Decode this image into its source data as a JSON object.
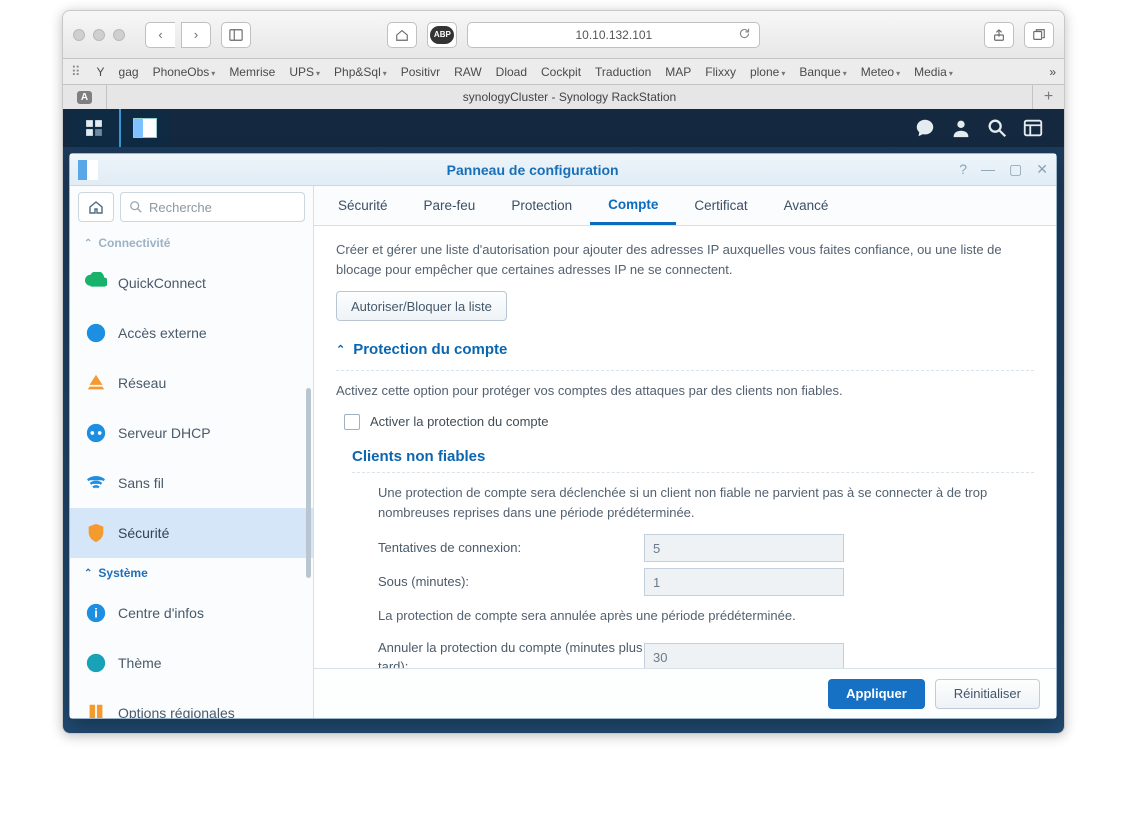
{
  "browser": {
    "address": "10.10.132.101",
    "tab_close_count": "A",
    "tab_title": "synologyCluster - Synology RackStation",
    "bookmarks": [
      "Y",
      "gag",
      "PhoneObs",
      "Memrise",
      "UPS",
      "Php&Sql",
      "Positivr",
      "RAW",
      "Dload",
      "Cockpit",
      "Traduction",
      "MAP",
      "Flixxy",
      "plone",
      "Banque",
      "Meteo",
      "Media"
    ],
    "bookmark_has_menu": [
      false,
      false,
      true,
      false,
      true,
      true,
      false,
      false,
      false,
      false,
      false,
      false,
      false,
      true,
      true,
      true,
      true
    ]
  },
  "cp": {
    "title": "Panneau de configuration",
    "search_placeholder": "Recherche",
    "section_connectivity": "Connectivité",
    "section_system": "Système",
    "nav": {
      "quickconnect": "QuickConnect",
      "external": "Accès externe",
      "network": "Réseau",
      "dhcp": "Serveur DHCP",
      "wifi": "Sans fil",
      "security": "Sécurité",
      "infocenter": "Centre d'infos",
      "theme": "Thème",
      "regional": "Options régionales"
    },
    "tabs": {
      "security": "Sécurité",
      "firewall": "Pare-feu",
      "protection": "Protection",
      "account": "Compte",
      "certificate": "Certificat",
      "advanced": "Avancé"
    },
    "content": {
      "ip_desc": "Créer et gérer une liste d'autorisation pour ajouter des adresses IP auxquelles vous faites confiance, ou une liste de blocage pour empêcher que certaines adresses IP ne se connectent.",
      "allow_block_btn": "Autoriser/Bloquer la liste",
      "acct_protect_head": "Protection du compte",
      "acct_protect_desc": "Activez cette option pour protéger vos comptes des attaques par des clients non fiables.",
      "enable_chk": "Activer la protection du compte",
      "untrusted_head": "Clients non fiables",
      "untrusted_desc": "Une protection de compte sera déclenchée si un client non fiable ne parvient pas à se connecter à de trop nombreuses reprises dans une période prédéterminée.",
      "attempts_label": "Tentatives de connexion:",
      "attempts_val": "5",
      "within_label": "Sous (minutes):",
      "within_val": "1",
      "cancel_desc": "La protection de compte sera annulée après une période prédéterminée.",
      "cancel_label": "Annuler la protection du compte (minutes plus tard):",
      "cancel_val": "30"
    },
    "footer": {
      "apply": "Appliquer",
      "reset": "Réinitialiser"
    }
  }
}
